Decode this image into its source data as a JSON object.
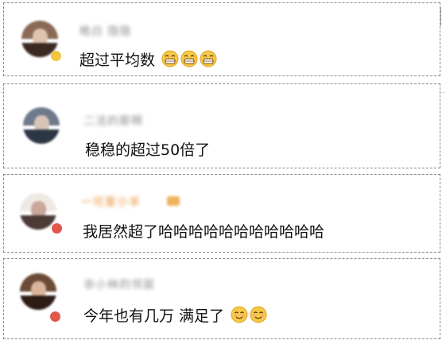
{
  "comments": [
    {
      "username": "皓白 隐隐",
      "text": "超过平均数",
      "emoji_count": 3,
      "emoji_kind": "grin-icon",
      "avatar_colors": [
        "#8a6a55",
        "#e0c3b0",
        "#3c2a22"
      ],
      "badge_color": "#f5c542",
      "highlight": false
    },
    {
      "username": "二活的那啊",
      "text": "稳稳的超过50倍了",
      "emoji_count": 0,
      "emoji_kind": "",
      "avatar_colors": [
        "#6d7a8c",
        "#d8c4b6",
        "#2d3645"
      ],
      "badge_color": "",
      "highlight": false
    },
    {
      "username": "一可爱小羊",
      "text": "我居然超了哈哈哈哈哈哈哈哈哈哈哈",
      "emoji_count": 0,
      "emoji_kind": "",
      "avatar_colors": [
        "#efe9e4",
        "#c9a79a",
        "#4b3a36"
      ],
      "badge_color": "#e2574c",
      "highlight": true
    },
    {
      "username": "非小林的邻居",
      "text": "今年也有几万 满足了",
      "emoji_count": 2,
      "emoji_kind": "smile-icon",
      "avatar_colors": [
        "#6b4a36",
        "#d9b49a",
        "#2c1c14"
      ],
      "badge_color": "#e2574c",
      "highlight": false
    }
  ]
}
